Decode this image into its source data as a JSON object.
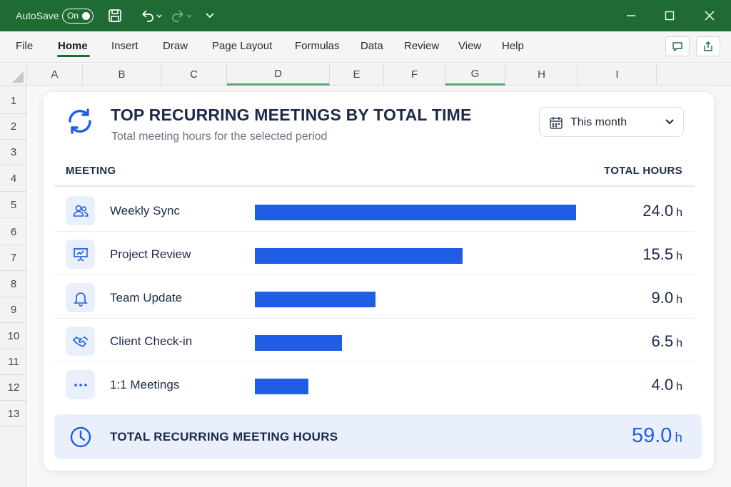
{
  "titlebar": {
    "autosave_label": "AutoSave",
    "autosave_state": "On"
  },
  "ribbon": {
    "tabs": [
      "File",
      "Home",
      "Insert",
      "Draw",
      "Page Layout",
      "Formulas",
      "Data",
      "Review",
      "View",
      "Help"
    ],
    "active_tab": "Home"
  },
  "grid": {
    "columns": [
      "A",
      "B",
      "C",
      "D",
      "E",
      "F",
      "G",
      "H",
      "I"
    ],
    "rows": [
      "1",
      "2",
      "3",
      "4",
      "5",
      "6",
      "7",
      "8",
      "9",
      "10",
      "11",
      "12",
      "13"
    ]
  },
  "card": {
    "title": "TOP RECURRING MEETINGS BY TOTAL TIME",
    "subtitle": "Total meeting hours for the selected period",
    "period": "This month",
    "col_meeting": "MEETING",
    "col_hours": "TOTAL HOURS",
    "unit": "h",
    "total_label": "TOTAL RECURRING MEETING HOURS",
    "total_value": "59.0"
  },
  "colors": {
    "bar": "#1f5de6",
    "titlebar": "#1e6b34",
    "heading": "#1b2a4a",
    "icon_bg": "#eaf0fb"
  },
  "chart_data": {
    "type": "bar",
    "orientation": "horizontal",
    "categories": [
      "Weekly Sync",
      "Project Review",
      "Team Update",
      "Client Check-in",
      "1:1 Meetings"
    ],
    "values": [
      24.0,
      15.5,
      9.0,
      6.5,
      4.0
    ],
    "value_labels": [
      "24.0",
      "15.5",
      "9.0",
      "6.5",
      "4.0"
    ],
    "icons": [
      "people-icon",
      "presentation-icon",
      "bell-icon",
      "handshake-icon",
      "more-icon"
    ],
    "xlim": [
      0,
      24
    ],
    "grid": false
  }
}
